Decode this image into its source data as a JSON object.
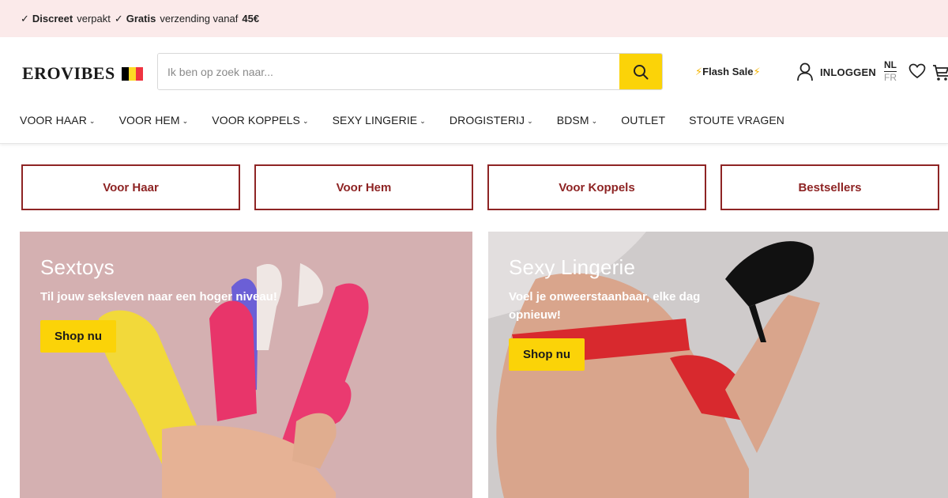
{
  "announcement": {
    "part1_bold": "Discreet",
    "part1_rest": "verpakt",
    "part2_bold": "Gratis",
    "part2_rest": "verzending vanaf",
    "part2_amount": "45€",
    "check": "✓"
  },
  "header": {
    "logo_text": "EROVIBES",
    "flag": [
      "#000000",
      "#fdda24",
      "#ef3340"
    ],
    "search": {
      "placeholder": "Ik ben op zoek naar..."
    },
    "flash_sale": "Flash Sale",
    "flash_icon": "⚡",
    "login_label": "INLOGGEN",
    "lang_active": "NL",
    "lang_other": "FR"
  },
  "nav": {
    "items": [
      {
        "label": "VOOR HAAR",
        "dropdown": true
      },
      {
        "label": "VOOR HEM",
        "dropdown": true
      },
      {
        "label": "VOOR KOPPELS",
        "dropdown": true
      },
      {
        "label": "SEXY LINGERIE",
        "dropdown": true
      },
      {
        "label": "DROGISTERIJ",
        "dropdown": true
      },
      {
        "label": "BDSM",
        "dropdown": true
      },
      {
        "label": "OUTLET",
        "dropdown": false
      },
      {
        "label": "STOUTE VRAGEN",
        "dropdown": false
      }
    ]
  },
  "quick_links": [
    "Voor Haar",
    "Voor Hem",
    "Voor Koppels",
    "Bestsellers"
  ],
  "banners": {
    "left": {
      "title": "Sextoys",
      "subtitle": "Til jouw seksleven naar een hoger niveau!",
      "cta": "Shop nu"
    },
    "right": {
      "title": "Sexy Lingerie",
      "subtitle_line1": "Voel je onweerstaanbaar, elke dag",
      "subtitle_line2": "opnieuw!",
      "cta": "Shop nu"
    }
  },
  "colors": {
    "accent_yellow": "#fbd308",
    "brand_red": "#8e2424",
    "announce_bg": "#fbeaea"
  }
}
